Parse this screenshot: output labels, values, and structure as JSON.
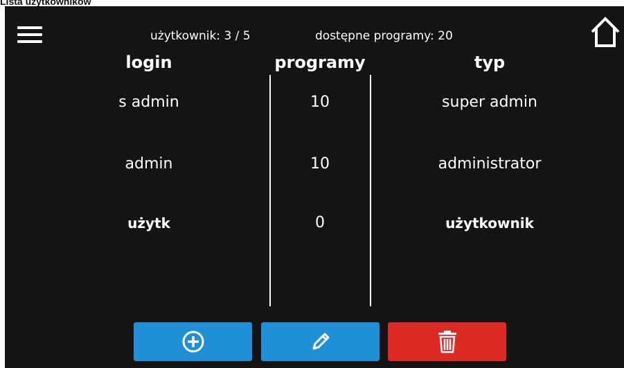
{
  "caption": "Lista użytkowników",
  "header": {
    "users_label": "użytkownik: 3 / 5",
    "programs_label": "dostępne programy: 20"
  },
  "columns": {
    "login": "login",
    "programs": "programy",
    "type": "typ"
  },
  "rows": [
    {
      "login": "s admin",
      "programs": "10",
      "type": "super admin"
    },
    {
      "login": "admin",
      "programs": "10",
      "type": "administrator"
    },
    {
      "login": "użytk",
      "programs": "0",
      "type": "użytkownik"
    }
  ],
  "buttons": [
    {
      "icon": "plus-circle-icon",
      "color": "#1f8fd6"
    },
    {
      "icon": "pencil-icon",
      "color": "#1f8fd6"
    },
    {
      "icon": "trash-icon",
      "color": "#de2a24"
    }
  ],
  "icons": {
    "menu": "hamburger-menu-icon",
    "home": "home-icon"
  },
  "colors": {
    "background": "#141414",
    "text": "#ffffff",
    "primary": "#1f8fd6",
    "danger": "#de2a24"
  }
}
